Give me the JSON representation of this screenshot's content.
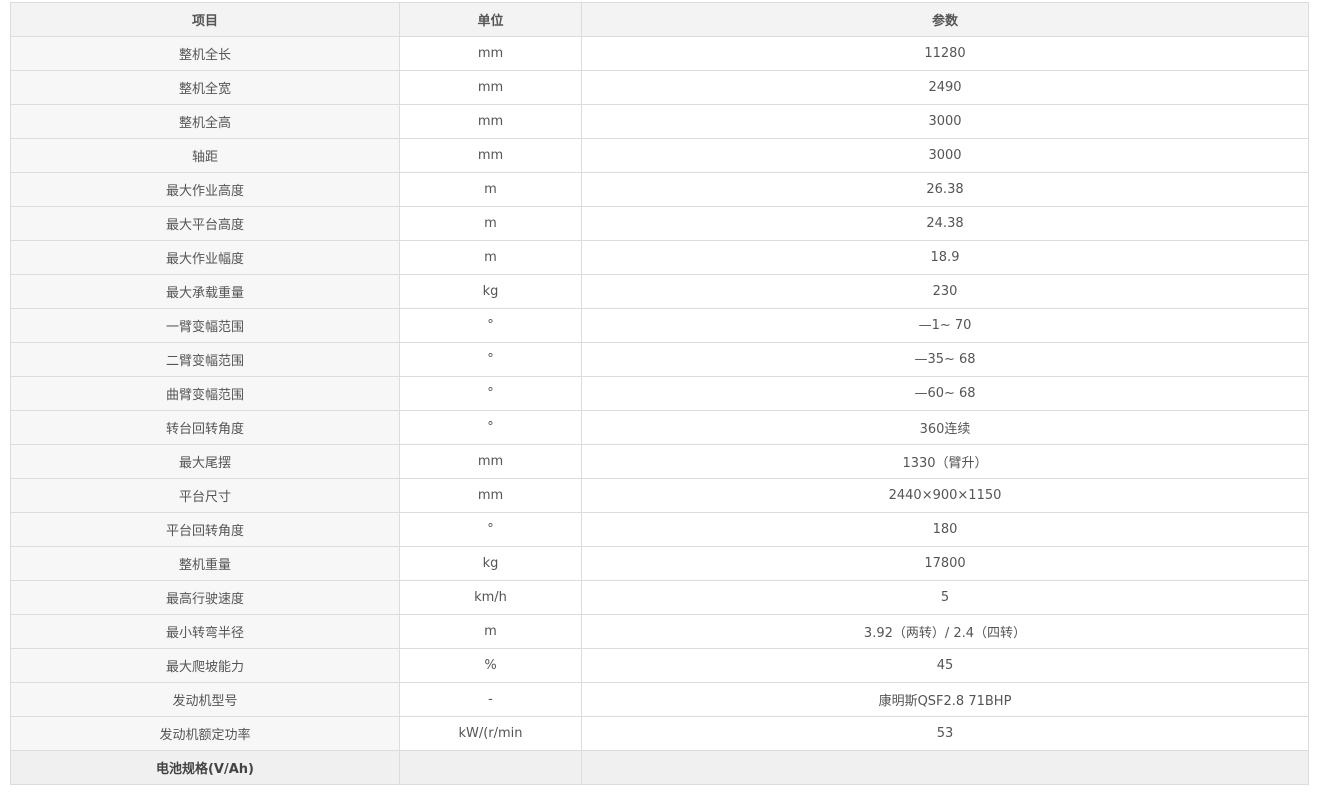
{
  "table": {
    "headers": [
      "项目",
      "单位",
      "参数"
    ],
    "rows": [
      [
        "整机全长",
        "mm",
        "11280"
      ],
      [
        "整机全宽",
        "mm",
        "2490"
      ],
      [
        "整机全高",
        "mm",
        "3000"
      ],
      [
        "轴距",
        "mm",
        "3000"
      ],
      [
        "最大作业高度",
        "m",
        "26.38"
      ],
      [
        "最大平台高度",
        "m",
        "24.38"
      ],
      [
        "最大作业幅度",
        "m",
        "18.9"
      ],
      [
        "最大承载重量",
        "kg",
        "230"
      ],
      [
        "一臂变幅范围",
        "°",
        "—1~ 70"
      ],
      [
        "二臂变幅范围",
        "°",
        "—35~ 68"
      ],
      [
        "曲臂变幅范围",
        "°",
        "—60~ 68"
      ],
      [
        "转台回转角度",
        "°",
        "360连续"
      ],
      [
        "最大尾摆",
        "mm",
        "1330（臂升）"
      ],
      [
        "平台尺寸",
        "mm",
        "2440×900×1150"
      ],
      [
        "平台回转角度",
        "°",
        "180"
      ],
      [
        "整机重量",
        "kg",
        "17800"
      ],
      [
        "最高行驶速度",
        "km/h",
        "5"
      ],
      [
        "最小转弯半径",
        "m",
        "3.92（两转）/ 2.4（四转）"
      ],
      [
        "最大爬坡能力",
        "%",
        "45"
      ],
      [
        "发动机型号",
        "-",
        "康明斯QSF2.8 71BHP"
      ],
      [
        "发动机额定功率",
        "kW/(r/min",
        "53"
      ]
    ],
    "footer_row": [
      "电池规格(V/Ah)",
      "",
      ""
    ]
  }
}
